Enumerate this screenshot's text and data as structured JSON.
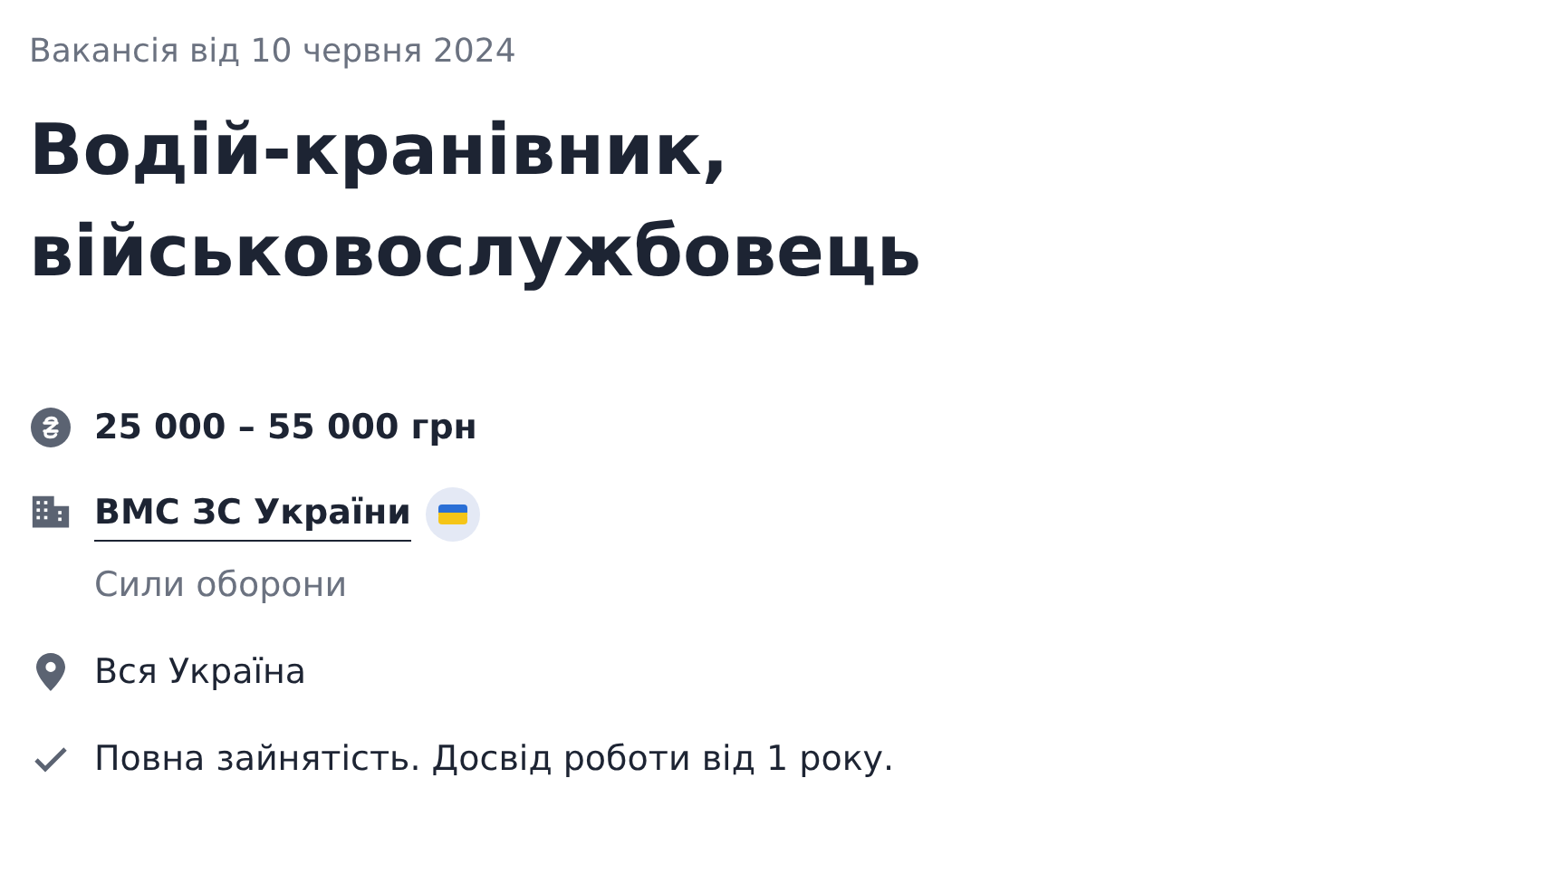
{
  "date": "Вакансія від 10 червня 2024",
  "title": "Водій-кранівник, військовослужбовець",
  "facts": [
    {
      "kind": "salary",
      "text": "25 000 – 55 000 грн"
    },
    {
      "kind": "company",
      "text": "ВМС ЗС України",
      "subtitle": "Сили оборони",
      "verified": true
    },
    {
      "kind": "location",
      "text": "Вся Україна"
    },
    {
      "kind": "details",
      "text": "Повна зайнятість. Досвід роботи від 1 року."
    }
  ]
}
